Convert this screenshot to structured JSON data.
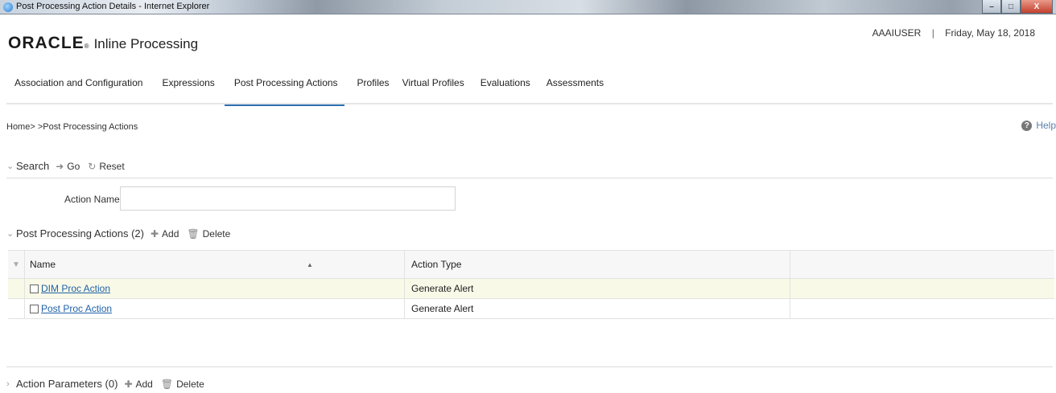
{
  "window": {
    "title": "Post Processing Action Details - Internet Explorer",
    "minimize": "–",
    "maximize": "□",
    "close": "X"
  },
  "header": {
    "brand": "ORACLE",
    "brand_mark": "®",
    "app_name": "Inline Processing",
    "user": "AAAIUSER",
    "separator": "|",
    "date": "Friday, May 18, 2018"
  },
  "tabs": [
    {
      "label": "Association and Configuration"
    },
    {
      "label": "Expressions"
    },
    {
      "label": "Post Processing Actions",
      "active": true
    },
    {
      "label": "Profiles"
    },
    {
      "label": "Virtual Profiles"
    },
    {
      "label": "Evaluations"
    },
    {
      "label": "Assessments"
    }
  ],
  "breadcrumb": "Home> >Post Processing Actions",
  "help": {
    "icon": "help-icon",
    "label": "Help"
  },
  "search": {
    "title": "Search",
    "go": "Go",
    "reset": "Reset",
    "fields": {
      "action_name_label": "Action Name",
      "action_name_value": ""
    }
  },
  "actions_section": {
    "title": "Post Processing Actions (2)",
    "add": "Add",
    "delete": "Delete",
    "columns": {
      "name": "Name",
      "action_type": "Action Type"
    },
    "rows": [
      {
        "name": "DIM Proc Action",
        "action_type": "Generate Alert"
      },
      {
        "name": "Post Proc Action",
        "action_type": "Generate Alert"
      }
    ]
  },
  "params_section": {
    "title": "Action Parameters (0)",
    "add": "Add",
    "delete": "Delete"
  },
  "colors": {
    "accent": "#2f6fb0",
    "link": "#1f62a8",
    "selected_row": "#f9f9e8"
  }
}
